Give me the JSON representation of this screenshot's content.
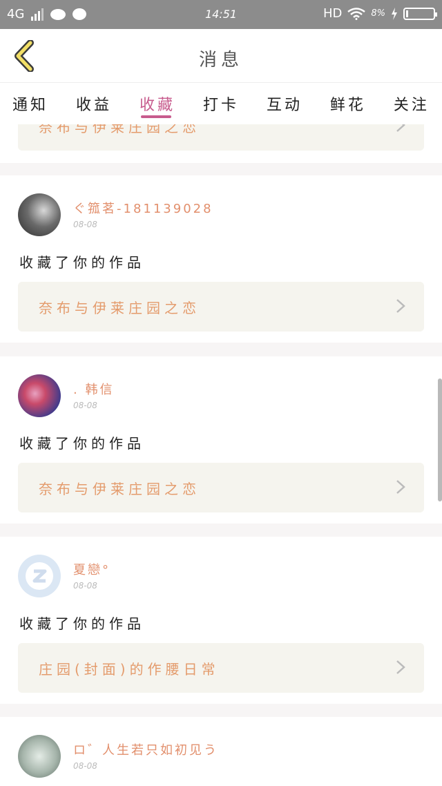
{
  "status_bar": {
    "network": "4G",
    "time": "14:51",
    "hd": "HD",
    "battery_text": "8%",
    "battery_level": 0.08
  },
  "header": {
    "title": "消息",
    "back_icon": "chevron-left-icon"
  },
  "tabs": [
    {
      "label": "通知",
      "active": false
    },
    {
      "label": "收益",
      "active": false
    },
    {
      "label": "收藏",
      "active": true
    },
    {
      "label": "打卡",
      "active": false
    },
    {
      "label": "互动",
      "active": false
    },
    {
      "label": "鲜花",
      "active": false
    },
    {
      "label": "关注",
      "active": false
    }
  ],
  "items": [
    {
      "work_title": "奈布与伊莱庄园之恋"
    },
    {
      "name": "ぐ箛茗-181139028",
      "date": "08-08",
      "action": "收藏了你的作品",
      "work_title": "奈布与伊莱庄园之恋",
      "avatar_colors": [
        "#3a3a3a",
        "#d8d8d8"
      ]
    },
    {
      "name": ". 韩信",
      "date": "08-08",
      "action": "收藏了你的作品",
      "work_title": "奈布与伊莱庄园之恋",
      "avatar_colors": [
        "#3d3a8c",
        "#c94a6a"
      ]
    },
    {
      "name": "夏戀°",
      "date": "08-08",
      "action": "收藏了你的作品",
      "work_title": "庄园(封面)的作腰日常",
      "avatar_colors": [
        "#dbe7f4",
        "#ffffff"
      ]
    },
    {
      "name": "ロ゛人生若只如初见う",
      "date": "08-08",
      "avatar_colors": [
        "#8a9a90",
        "#e4ece6"
      ]
    }
  ]
}
